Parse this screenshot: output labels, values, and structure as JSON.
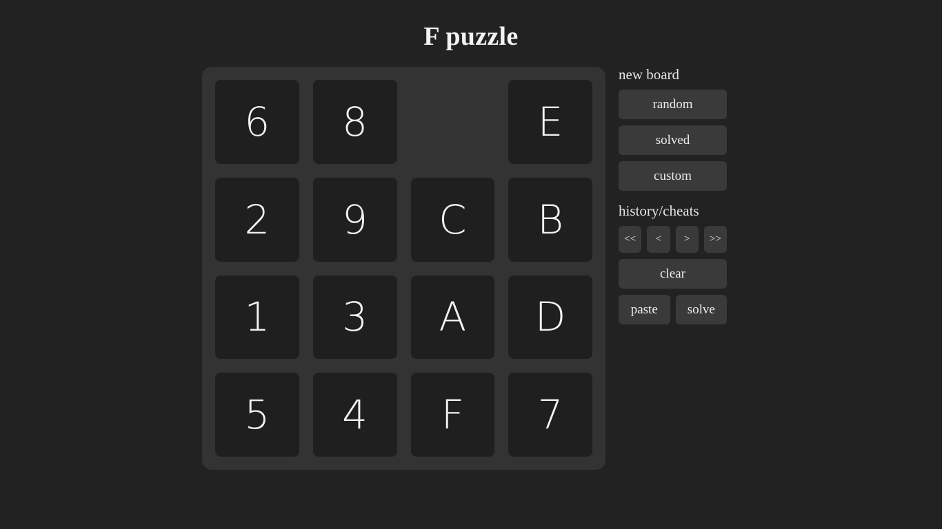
{
  "page": {
    "title": "F puzzle",
    "background_color": "#222222",
    "board_color": "#333333",
    "tile_color": "#1f1f1f",
    "button_color": "#3a3a3a",
    "text_color": "#f2f2f2"
  },
  "board": {
    "columns": 4,
    "rows": 4,
    "tiles": [
      {
        "label": "6",
        "empty": false
      },
      {
        "label": "8",
        "empty": false
      },
      {
        "label": "",
        "empty": true
      },
      {
        "label": "E",
        "empty": false
      },
      {
        "label": "2",
        "empty": false
      },
      {
        "label": "9",
        "empty": false
      },
      {
        "label": "C",
        "empty": false
      },
      {
        "label": "B",
        "empty": false
      },
      {
        "label": "1",
        "empty": false
      },
      {
        "label": "3",
        "empty": false
      },
      {
        "label": "A",
        "empty": false
      },
      {
        "label": "D",
        "empty": false
      },
      {
        "label": "5",
        "empty": false
      },
      {
        "label": "4",
        "empty": false
      },
      {
        "label": "F",
        "empty": false
      },
      {
        "label": "7",
        "empty": false
      }
    ]
  },
  "sidebar": {
    "new_board": {
      "label": "new board",
      "buttons": [
        {
          "label": "random"
        },
        {
          "label": "solved"
        },
        {
          "label": "custom"
        }
      ]
    },
    "history": {
      "label": "history/cheats",
      "nav_buttons": [
        {
          "label": "<<"
        },
        {
          "label": "<"
        },
        {
          "label": ">"
        },
        {
          "label": ">>"
        }
      ],
      "clear_button": {
        "label": "clear"
      },
      "action_buttons": [
        {
          "label": "paste"
        },
        {
          "label": "solve"
        }
      ]
    }
  }
}
